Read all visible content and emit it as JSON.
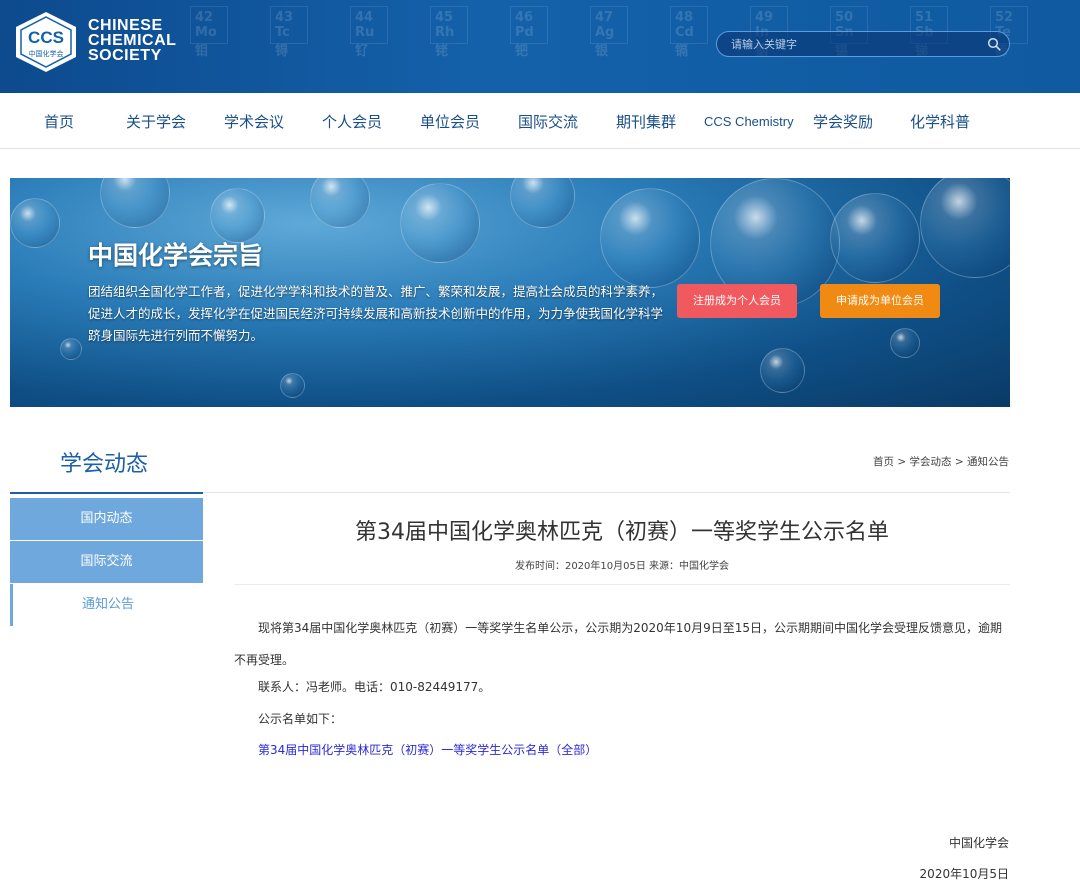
{
  "header": {
    "logo_abbr": "CCS",
    "logo_cn": "中国化学会",
    "logo_lines": [
      "CHINESE",
      "CHEMICAL",
      "SOCIETY"
    ],
    "search_placeholder": "请输入关键字",
    "periodic_cells": [
      "42 Mo",
      "43 Tc",
      "44 Ru",
      "45 Rh",
      "46 Pd",
      "47 Ag",
      "48 Cd",
      "49 In",
      "50 Sn",
      "51 Sb",
      "52 Te"
    ],
    "periodic_cn": [
      "钼",
      "锝",
      "钌",
      "铑",
      "钯",
      "银",
      "镉",
      "铟",
      "锡",
      "锑",
      "碲"
    ]
  },
  "nav": {
    "items": [
      "首页",
      "关于学会",
      "学术会议",
      "个人会员",
      "单位会员",
      "国际交流",
      "期刊集群",
      "CCS Chemistry",
      "学会奖励",
      "化学科普"
    ]
  },
  "banner": {
    "title": "中国化学会宗旨",
    "desc": "团结组织全国化学工作者，促进化学学科和技术的普及、推广、繁荣和发展，提高社会成员的科学素养，促进人才的成长，发挥化学在促进国民经济可持续发展和高新技术创新中的作用，为力争使我国化学科学跻身国际先进行列而不懈努力。",
    "btn_individual": "注册成为个人会员",
    "btn_org": "申请成为单位会员"
  },
  "section": {
    "title": "学会动态",
    "breadcrumb": [
      "首页",
      "学会动态",
      "通知公告"
    ]
  },
  "sidebar": {
    "items": [
      "国内动态",
      "国际交流",
      "通知公告"
    ]
  },
  "article": {
    "title": "第34届中国化学奥林匹克（初赛）一等奖学生公示名单",
    "meta": "发布时间：2020年10月05日 来源：中国化学会",
    "p1": "现将第34届中国化学奥林匹克（初赛）一等奖学生名单公示，公示期为2020年10月9日至15日，公示期期间中国化学会受理反馈意见，逾期不再受理。",
    "p2": "联系人：冯老师。电话：010-82449177。",
    "p3": "公示名单如下：",
    "link": "第34届中国化学奥林匹克（初赛）一等奖学生公示名单（全部）",
    "sign_org": "中国化学会",
    "sign_date": "2020年10月5日"
  },
  "colors": {
    "header_blue": "#0d4a8e",
    "nav_text": "#1a4f8a",
    "accent_blue": "#1a5fa8",
    "sidebar_blue": "#6fa8dc",
    "btn_red": "#f05a5f",
    "btn_orange": "#f08a12",
    "link_blue": "#2a2ad8"
  },
  "icons": {
    "logo": "ccs-hexagon-logo-icon",
    "search": "search-icon"
  }
}
